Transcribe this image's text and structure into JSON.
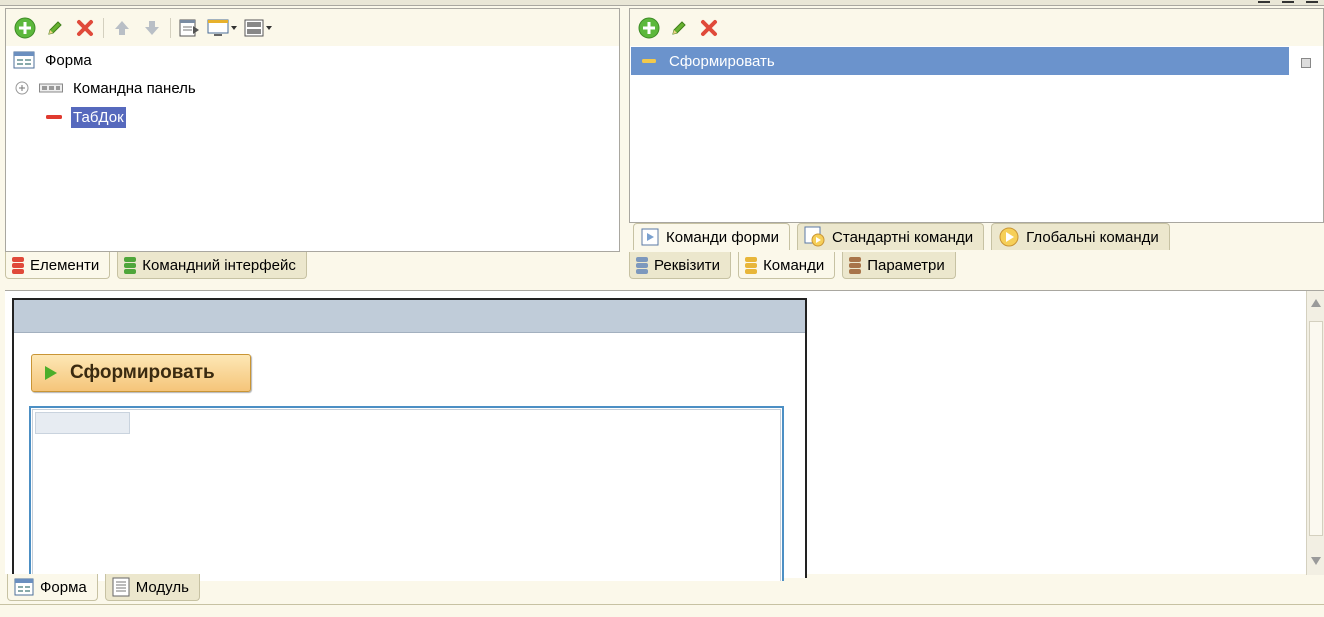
{
  "elements_panel": {
    "toolbar": {
      "add": "add-icon",
      "edit": "edit-icon",
      "delete": "delete-icon",
      "move_up": "arrow-up-icon",
      "move_down": "arrow-down-icon",
      "preview": "form-preview-icon",
      "display": "monitor-icon",
      "layout": "layout-icon"
    },
    "tree": [
      {
        "label": "Форма",
        "icon": "form-icon"
      },
      {
        "label": "Командна панель",
        "icon": "command-bar-icon"
      },
      {
        "label": "ТабДок",
        "icon": "spreadsheet-icon",
        "selected": true
      }
    ],
    "tabs": [
      {
        "label": "Елементи",
        "active": true
      },
      {
        "label": "Командний інтерфейс",
        "active": false
      }
    ]
  },
  "commands_panel": {
    "toolbar": {
      "add": "add-icon",
      "edit": "edit-icon",
      "delete": "delete-icon"
    },
    "rows": [
      {
        "label": "Сформировать",
        "selected": true
      }
    ],
    "sub_tabs": [
      {
        "label": "Команди форми",
        "active": true
      },
      {
        "label": "Стандартні команди",
        "active": false
      },
      {
        "label": "Глобальні команди",
        "active": false
      }
    ],
    "tabs": [
      {
        "label": "Реквізити",
        "active": false
      },
      {
        "label": "Команди",
        "active": true
      },
      {
        "label": "Параметри",
        "active": false
      }
    ]
  },
  "designer": {
    "form_button_label": "Сформировать"
  },
  "bottom_tabs": [
    {
      "label": "Форма",
      "active": true
    },
    {
      "label": "Модуль",
      "active": false
    }
  ],
  "colors": {
    "selection_blue": "#6b93cc",
    "tree_selection": "#5669bd",
    "panel_bg": "#fbf8ea",
    "button_orange": "#f5c57a"
  }
}
